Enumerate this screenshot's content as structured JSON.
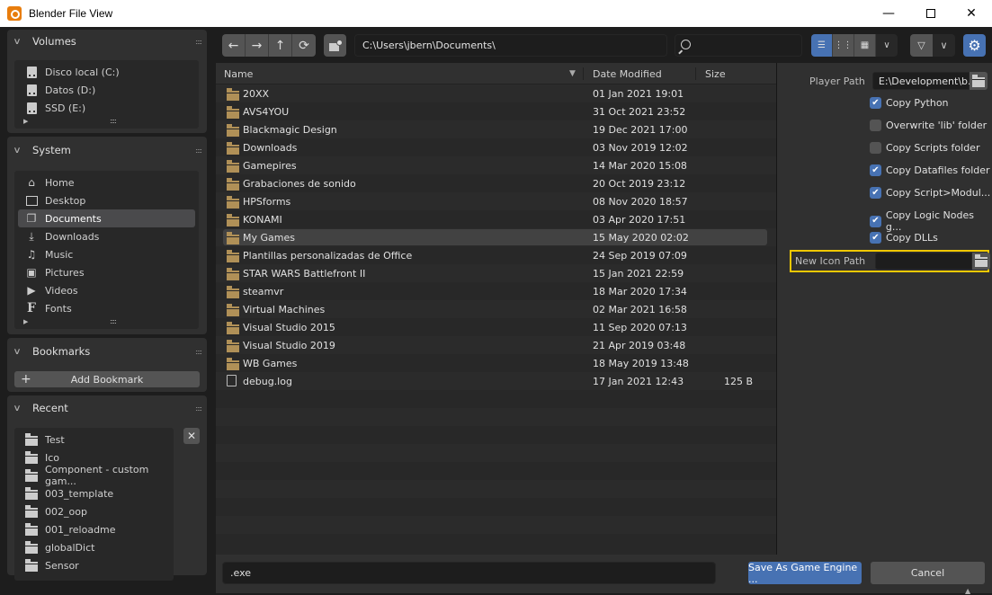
{
  "window": {
    "title": "Blender File View",
    "minimize_icon": "minimize-icon",
    "maximize_icon": "maximize-icon",
    "close_icon": "close-icon"
  },
  "sidebar": {
    "volumes": {
      "title": "Volumes",
      "items": [
        {
          "label": "Disco local (C:)",
          "icon": "drive-icon"
        },
        {
          "label": "Datos (D:)",
          "icon": "drive-icon"
        },
        {
          "label": "SSD (E:)",
          "icon": "drive-icon"
        }
      ]
    },
    "system": {
      "title": "System",
      "items": [
        {
          "label": "Home",
          "icon": "home-icon"
        },
        {
          "label": "Desktop",
          "icon": "desktop-icon"
        },
        {
          "label": "Documents",
          "icon": "documents-icon",
          "selected": true
        },
        {
          "label": "Downloads",
          "icon": "download-icon"
        },
        {
          "label": "Music",
          "icon": "music-icon"
        },
        {
          "label": "Pictures",
          "icon": "picture-icon"
        },
        {
          "label": "Videos",
          "icon": "video-icon"
        },
        {
          "label": "Fonts",
          "icon": "font-icon"
        }
      ]
    },
    "bookmarks": {
      "title": "Bookmarks",
      "add_label": "Add Bookmark"
    },
    "recent": {
      "title": "Recent",
      "items": [
        {
          "label": "Test"
        },
        {
          "label": "Ico"
        },
        {
          "label": "Component - custom gam..."
        },
        {
          "label": "003_template"
        },
        {
          "label": "002_oop"
        },
        {
          "label": "001_reloadme"
        },
        {
          "label": "globalDict"
        },
        {
          "label": "Sensor"
        }
      ]
    }
  },
  "toolbar": {
    "back_icon": "←",
    "forward_icon": "→",
    "parent_icon": "↑",
    "refresh_icon": "⟳",
    "path": "C:\\Users\\jbern\\Documents\\",
    "search_placeholder": "",
    "search_value": ""
  },
  "filelist": {
    "columns": {
      "name": "Name",
      "date": "Date Modified",
      "size": "Size"
    },
    "sort_indicator": "▼",
    "rows": [
      {
        "name": "20XX",
        "date": "01 Jan 2021 19:01",
        "size": "",
        "type": "folder"
      },
      {
        "name": "AVS4YOU",
        "date": "31 Oct 2021 23:52",
        "size": "",
        "type": "folder"
      },
      {
        "name": "Blackmagic Design",
        "date": "19 Dec 2021 17:00",
        "size": "",
        "type": "folder"
      },
      {
        "name": "Downloads",
        "date": "03 Nov 2019 12:02",
        "size": "",
        "type": "folder"
      },
      {
        "name": "Gamepires",
        "date": "14 Mar 2020 15:08",
        "size": "",
        "type": "folder"
      },
      {
        "name": "Grabaciones de sonido",
        "date": "20 Oct 2019 23:12",
        "size": "",
        "type": "folder"
      },
      {
        "name": "HPSforms",
        "date": "08 Nov 2020 18:57",
        "size": "",
        "type": "folder"
      },
      {
        "name": "KONAMI",
        "date": "03 Apr 2020 17:51",
        "size": "",
        "type": "folder"
      },
      {
        "name": "My Games",
        "date": "15 May 2020 02:02",
        "size": "",
        "type": "folder",
        "selected": true
      },
      {
        "name": "Plantillas personalizadas de Office",
        "date": "24 Sep 2019 07:09",
        "size": "",
        "type": "folder"
      },
      {
        "name": "STAR WARS Battlefront II",
        "date": "15 Jan 2021 22:59",
        "size": "",
        "type": "folder"
      },
      {
        "name": "steamvr",
        "date": "18 Mar 2020 17:34",
        "size": "",
        "type": "folder"
      },
      {
        "name": "Virtual Machines",
        "date": "02 Mar 2021 16:58",
        "size": "",
        "type": "folder"
      },
      {
        "name": "Visual Studio 2015",
        "date": "11 Sep 2020 07:13",
        "size": "",
        "type": "folder"
      },
      {
        "name": "Visual Studio 2019",
        "date": "21 Apr 2019 03:48",
        "size": "",
        "type": "folder"
      },
      {
        "name": "WB Games",
        "date": "18 May 2019 13:48",
        "size": "",
        "type": "folder"
      },
      {
        "name": "debug.log",
        "date": "17 Jan 2021 12:43",
        "size": "125 B",
        "type": "file"
      }
    ]
  },
  "properties": {
    "player_path_label": "Player Path",
    "player_path_value": "E:\\Development\\b...",
    "options": [
      {
        "label": "Copy Python",
        "checked": true
      },
      {
        "label": "Overwrite 'lib' folder",
        "checked": false
      },
      {
        "label": "Copy Scripts folder",
        "checked": false
      },
      {
        "label": "Copy Datafiles folder",
        "checked": true
      },
      {
        "label": "Copy Script>Modul...",
        "checked": true
      },
      {
        "label": "Copy Logic Nodes g...",
        "checked": true
      },
      {
        "label": "Copy DLLs",
        "checked": true
      }
    ],
    "icon_path_label": "New Icon Path",
    "icon_path_value": "",
    "highlight_color": "#f0c800"
  },
  "bottom": {
    "filename": ".exe",
    "save_label": "Save As Game Engine ...",
    "cancel_label": "Cancel"
  },
  "colors": {
    "accent": "#4772b3",
    "folder": "#b09057"
  }
}
